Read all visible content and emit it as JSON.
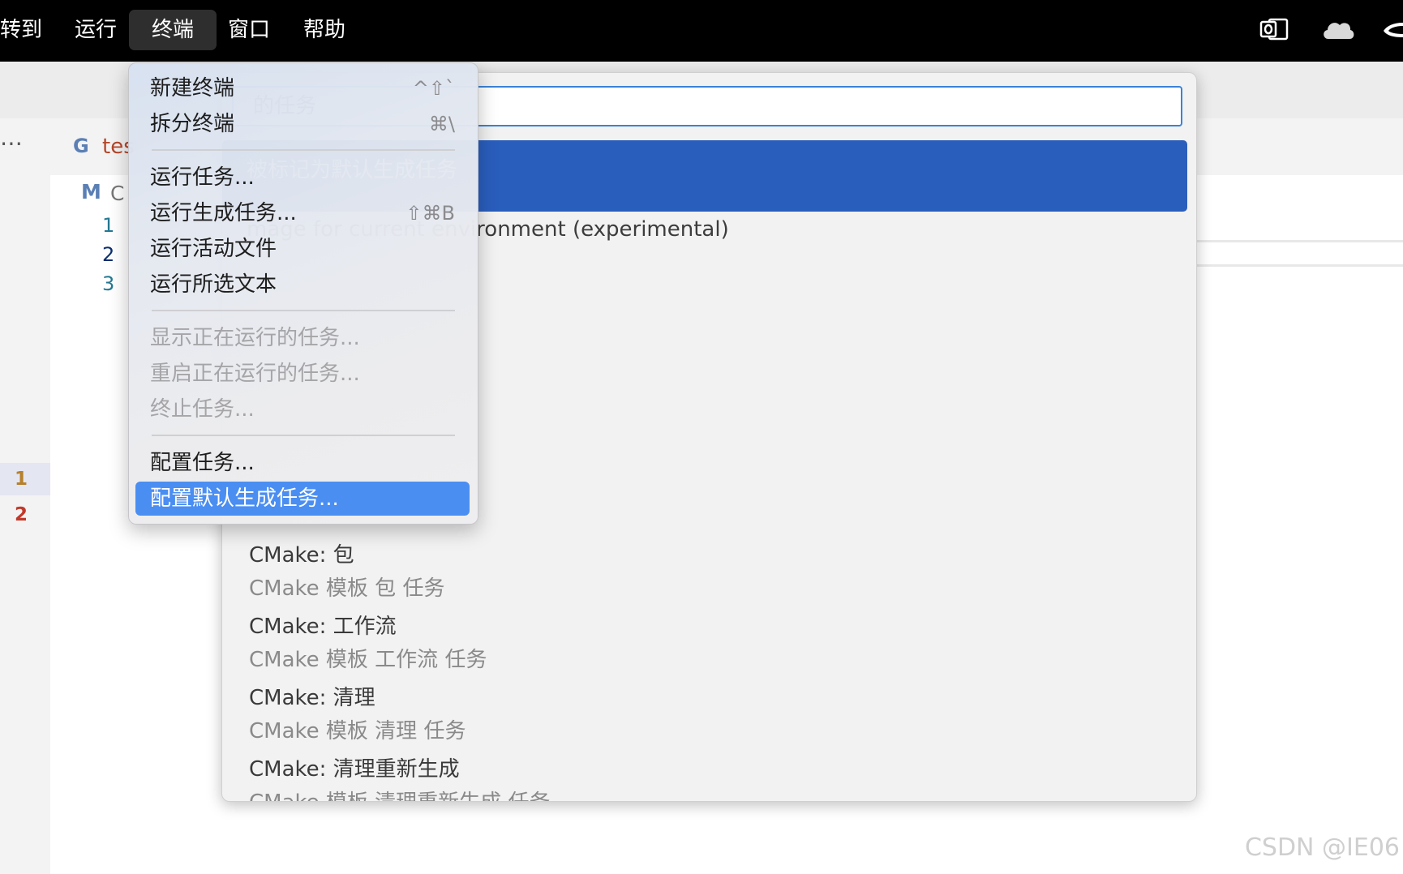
{
  "menubar": {
    "items": [
      "转到",
      "运行",
      "终端",
      "窗口",
      "帮助"
    ],
    "active_index": 2,
    "tray_icons": [
      "outlook-icon",
      "cloud-icon",
      "onedrive-icon"
    ]
  },
  "editor": {
    "more_actions": "⋯",
    "tab_icon": "G",
    "tab_label": "tes",
    "file_icon": "M",
    "file_label": "C",
    "line_numbers": [
      "1",
      "2",
      "3"
    ],
    "gutter_numbers": [
      "1",
      "2"
    ],
    "gutter_colors": {
      "first": "#b6802c",
      "second": "#c0392b"
    }
  },
  "quickpick": {
    "input_value": "的任务",
    "selected_item": "被标记为默认生成任务",
    "row2_text": "mage for current environment (experimental)",
    "items": [
      {
        "title": "CMake: 包",
        "desc": "CMake 模板 包 任务"
      },
      {
        "title": "CMake: 工作流",
        "desc": "CMake 模板 工作流 任务"
      },
      {
        "title": "CMake: 清理",
        "desc": "CMake 模板 清理 任务"
      },
      {
        "title": "CMake: 清理重新生成",
        "desc": "CMake 模板 清理重新生成 任务"
      }
    ]
  },
  "terminal_menu": {
    "items": [
      {
        "label": "新建终端",
        "shortcut": "^⇧`",
        "disabled": false
      },
      {
        "label": "拆分终端",
        "shortcut": "⌘\\",
        "disabled": false
      },
      {
        "label": "运行任务...",
        "shortcut": "",
        "disabled": false
      },
      {
        "label": "运行生成任务...",
        "shortcut": "⇧⌘B",
        "disabled": false
      },
      {
        "label": "运行活动文件",
        "shortcut": "",
        "disabled": false
      },
      {
        "label": "运行所选文本",
        "shortcut": "",
        "disabled": false
      },
      {
        "label": "显示正在运行的任务...",
        "shortcut": "",
        "disabled": true
      },
      {
        "label": "重启正在运行的任务...",
        "shortcut": "",
        "disabled": true
      },
      {
        "label": "终止任务...",
        "shortcut": "",
        "disabled": true
      },
      {
        "label": "配置任务...",
        "shortcut": "",
        "disabled": false
      },
      {
        "label": "配置默认生成任务...",
        "shortcut": "",
        "disabled": false
      }
    ],
    "highlighted_index": 10
  },
  "watermark": "CSDN @IE06",
  "colors": {
    "menubar_bg": "#000000",
    "selection_blue": "#2a5ebd",
    "menu_highlight": "#4a8ef2",
    "input_border": "#3b82d6"
  }
}
